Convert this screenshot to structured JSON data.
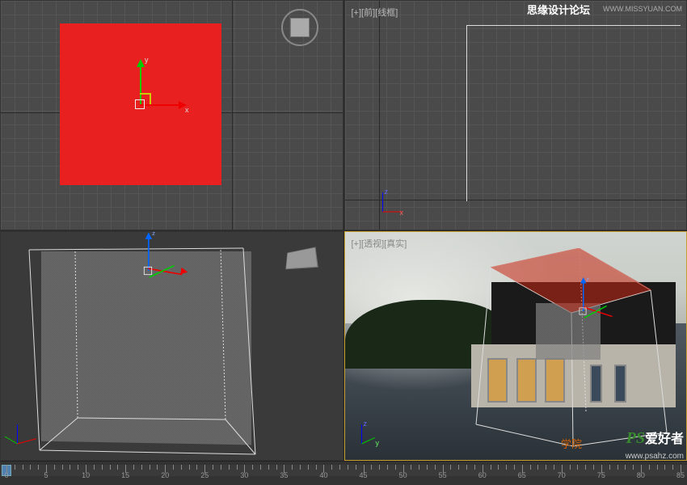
{
  "viewports": {
    "top_left": {
      "label": ""
    },
    "top_right": {
      "label": "[+][前][线框]"
    },
    "bottom_left": {
      "label": ""
    },
    "bottom_right": {
      "label": "[+][透视][真实]"
    }
  },
  "axes": {
    "x": "x",
    "y": "y",
    "z": "z"
  },
  "timeline": {
    "frames": [
      0,
      5,
      10,
      15,
      20,
      25,
      30,
      35,
      40,
      45,
      50,
      55,
      60,
      65,
      70,
      75,
      80,
      85
    ],
    "current": 0
  },
  "watermarks": {
    "forum": "思缘设计论坛",
    "domain1": "WWW.MISSYUAN.COM",
    "logo_ps": "PS",
    "logo_text": "爱好者",
    "logo_url": "www.psahz.com",
    "academy": "学院"
  },
  "chart_data": null
}
